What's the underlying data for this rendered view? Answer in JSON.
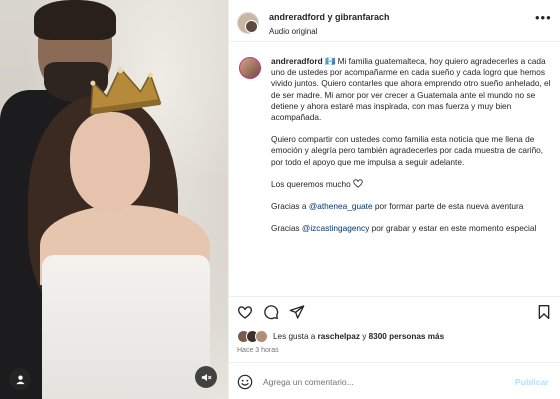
{
  "header": {
    "user": "andreradford y gibranfarach",
    "audio": "Audio original",
    "more_icon": "more-horizontal-icon"
  },
  "caption": {
    "user": "andreradford",
    "paragraphs": [
      "🇬🇹 Mi familia guatemalteca, hoy quiero agradecerles a cada uno de ustedes por acompañarme en cada sueño y cada logro que hemos vivido juntos. Quiero contarles que ahora emprendo otro sueño anhelado, el de ser madre. Mi amor por ver crecer a Guatemala ante el mundo no se detiene y ahora estaré mas inspirada, con mas fuerza y muy bien acompañada.",
      "Quiero compartir con ustedes como familia esta noticia que me llena de emoción y alegría pero también agradecerles por cada muestra de cariño, por todo el apoyo que me impulsa a seguir adelante.",
      "Los queremos mucho"
    ],
    "thanks1": {
      "prefix": "Gracias a ",
      "mention": "@athenea_guate",
      "suffix": " por formar parte de esta nueva aventura"
    },
    "thanks2": {
      "prefix": "Gracias ",
      "mention": "@izcastingagency",
      "suffix": " por grabar y estar en este momento especial"
    }
  },
  "likes": {
    "prefix": "Les gusta a ",
    "user": "raschelpaz",
    "conj": " y ",
    "count": "8300 personas más"
  },
  "time": "Hace 3 horas",
  "comment": {
    "placeholder": "Agrega un comentario...",
    "publish_label": "Publicar"
  },
  "colors": {
    "mention": "#00376b",
    "publish_disabled": "#b2dffc",
    "muted": "#737373"
  }
}
